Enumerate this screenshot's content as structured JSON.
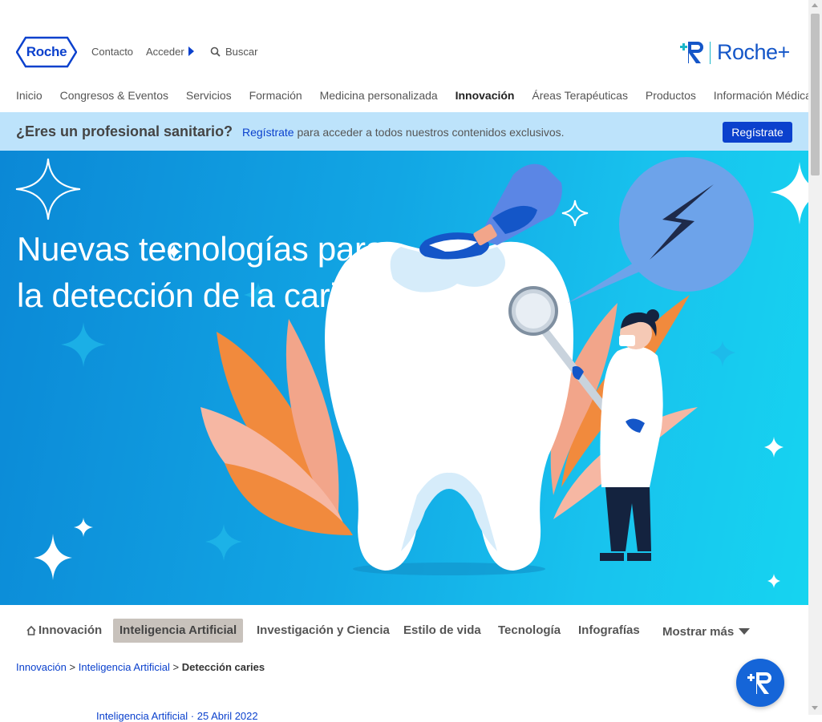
{
  "header": {
    "logo_text": "Roche",
    "contact_label": "Contacto",
    "login_label": "Acceder",
    "search_placeholder": "Buscar",
    "brand_plus_text": "Roche+"
  },
  "nav": {
    "items": [
      {
        "label": "Inicio"
      },
      {
        "label": "Congresos & Eventos"
      },
      {
        "label": "Servicios"
      },
      {
        "label": "Formación"
      },
      {
        "label": "Medicina personalizada"
      },
      {
        "label": "Innovación",
        "active": true
      },
      {
        "label": "Áreas Terapéuticas"
      },
      {
        "label": "Productos"
      },
      {
        "label": "Información Médica"
      }
    ]
  },
  "banner": {
    "question": "¿Eres un profesional sanitario?",
    "link_text": "Regístrate",
    "message": " para acceder a todos nuestros contenidos exclusivos.",
    "button_label": "Regístrate"
  },
  "hero": {
    "title": "Nuevas tecnologías para la detección de la caries"
  },
  "tabs": {
    "items": [
      {
        "label": "Innovación",
        "icon": "home-icon"
      },
      {
        "label": "Inteligencia Artificial",
        "active": true
      },
      {
        "label": "Investigación y Ciencia"
      },
      {
        "label": "Estilo de vida"
      },
      {
        "label": "Tecnología"
      },
      {
        "label": "Infografías"
      }
    ],
    "more_label": "Mostrar más"
  },
  "breadcrumb": {
    "items": [
      "Innovación",
      "Inteligencia Artificial"
    ],
    "separator": ">",
    "current": "Detección caries"
  },
  "partial_text": "Inteligencia Artificial · 25 Abril 2022",
  "colors": {
    "brand_blue": "#0b41cd",
    "banner_bg": "#bde3fb",
    "hero_blue": "#12a6e4",
    "tab_active_bg": "#c8c2bc"
  }
}
